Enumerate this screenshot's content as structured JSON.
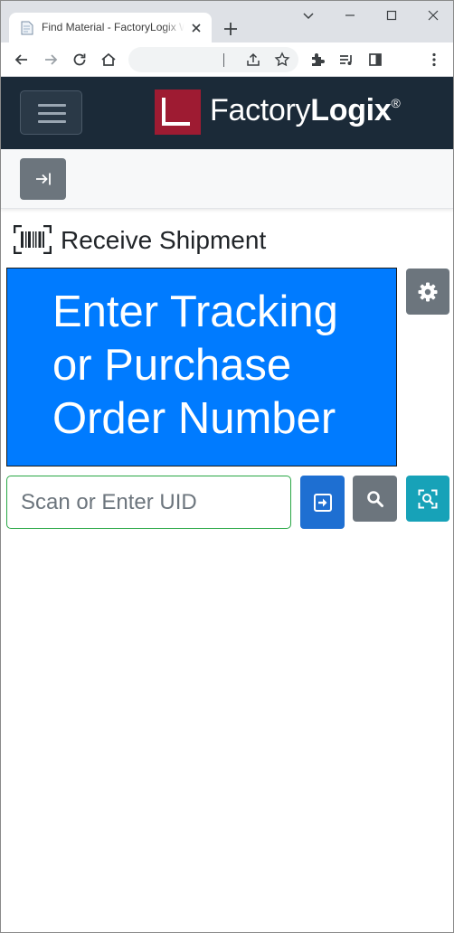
{
  "browser": {
    "tab_title": "Find Material - FactoryLogix Web",
    "address": ""
  },
  "navbar": {
    "logo_prefix": "Factory",
    "logo_bold": "Logix",
    "logo_mark": "®"
  },
  "page": {
    "title": "Receive Shipment",
    "prompt_lines": [
      "Enter Tracking",
      "or Purchase",
      "Order Number"
    ]
  },
  "scan": {
    "placeholder": "Scan or Enter UID",
    "value": ""
  },
  "icons": {
    "title": "barcode-scan-icon",
    "settings": "gear-icon",
    "enter": "enter-arrow-icon",
    "search": "search-icon",
    "camera": "scan-camera-icon",
    "collapse": "collapse-arrow-icon",
    "menu": "hamburger-menu-icon"
  },
  "colors": {
    "navbar": "#1b2a38",
    "prompt_bg": "#007bff",
    "logo_red": "#9e1b32",
    "enter_btn": "#1e6fd2",
    "secondary_btn": "#6c757d",
    "camera_btn": "#17a2b8",
    "input_border": "#28a745"
  }
}
